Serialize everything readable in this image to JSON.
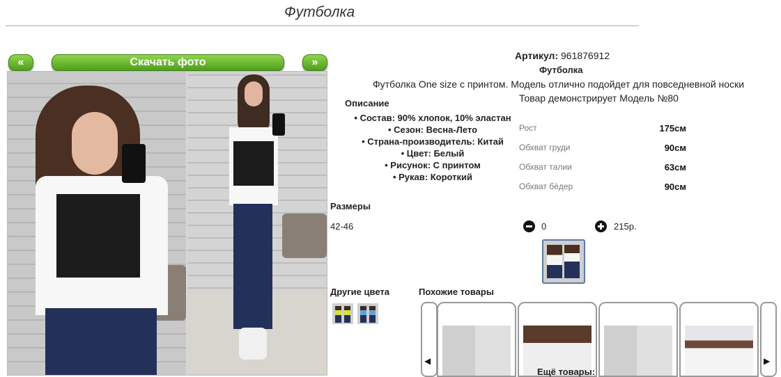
{
  "page": {
    "title": "Футболка"
  },
  "gallery": {
    "prev_label": "«",
    "next_label": "»",
    "download_label": "Скачать фото"
  },
  "product": {
    "article_label": "Артикул:",
    "article_value": "961876912",
    "name": "Футболка",
    "description": "Футболка One size с принтом. Модель отлично подойдет для повседневной носки",
    "model_note": "Товар демонстрирует Модель №80"
  },
  "details": {
    "heading": "Описание",
    "items": [
      "Состав: 90% хлопок, 10% эластан",
      "Сезон: Весна-Лето",
      "Страна-производитель: Китай",
      "Цвет: Белый",
      "Рисунок: С принтом",
      "Рукав: Короткий"
    ]
  },
  "measurements": [
    {
      "label": "Рост",
      "value": "175см"
    },
    {
      "label": "Обхват груди",
      "value": "90см"
    },
    {
      "label": "Обхват талии",
      "value": "63см"
    },
    {
      "label": "Обхват бёдер",
      "value": "90см"
    }
  ],
  "sizes": {
    "heading": "Размеры",
    "range": "42-46",
    "quantity": "0",
    "price": "215р."
  },
  "other_colors": {
    "heading": "Другие цвета"
  },
  "similar": {
    "heading": "Похожие товары",
    "more_label": "Ещё товары:"
  },
  "colors": {
    "button_green": "#5aa826",
    "thumb_border": "#5a7aa8"
  },
  "icons": [
    "minus-circle-icon",
    "plus-circle-icon",
    "prev-arrow-icon",
    "next-arrow-icon"
  ]
}
